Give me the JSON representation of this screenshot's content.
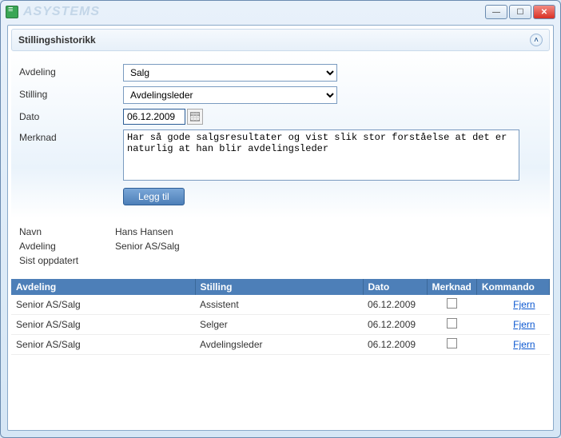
{
  "window": {
    "watermark": "ASYSTEMS"
  },
  "panel": {
    "title": "Stillingshistorikk"
  },
  "form": {
    "labels": {
      "avdeling": "Avdeling",
      "stilling": "Stilling",
      "dato": "Dato",
      "merknad": "Merknad"
    },
    "avdeling_value": "Salg",
    "stilling_value": "Avdelingsleder",
    "dato_value": "06.12.2009",
    "merknad_value": "Har så gode salgsresultater og vist slik stor forståelse at det er naturlig at han blir avdelingsleder",
    "add_button": "Legg til"
  },
  "info": {
    "labels": {
      "navn": "Navn",
      "avdeling": "Avdeling",
      "sist_oppdatert": "Sist oppdatert"
    },
    "navn": "Hans Hansen",
    "avdeling": "Senior AS/Salg",
    "sist_oppdatert": ""
  },
  "grid": {
    "headers": {
      "avdeling": "Avdeling",
      "stilling": "Stilling",
      "dato": "Dato",
      "merknad": "Merknad",
      "kommando": "Kommando"
    },
    "rows": [
      {
        "avdeling": "Senior AS/Salg",
        "stilling": "Assistent",
        "dato": "06.12.2009",
        "kommando": "Fjern"
      },
      {
        "avdeling": "Senior AS/Salg",
        "stilling": "Selger",
        "dato": "06.12.2009",
        "kommando": "Fjern"
      },
      {
        "avdeling": "Senior AS/Salg",
        "stilling": "Avdelingsleder",
        "dato": "06.12.2009",
        "kommando": "Fjern"
      }
    ]
  }
}
